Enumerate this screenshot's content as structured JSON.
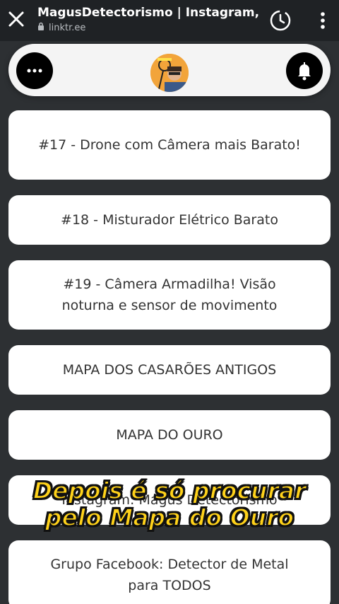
{
  "browser": {
    "title": "MagusDetectorismo | Instagram,",
    "url": "linktr.ee"
  },
  "header": {
    "menu_icon": "more-horizontal-icon",
    "notify_icon": "bell-icon",
    "avatar_alt": "profile avatar"
  },
  "links": [
    {
      "label": "#17 - Drone com Câmera mais Barato!"
    },
    {
      "label": "#18 - Misturador Elétrico Barato"
    },
    {
      "label": "#19 - Câmera Armadilha! Visão noturna e sensor de movimento"
    },
    {
      "label": "MAPA DOS CASARÕES ANTIGOS"
    },
    {
      "label": "MAPA DO OURO"
    },
    {
      "label": "Instagram: Magus Detectorismo"
    },
    {
      "label": "Grupo Facebook: Detector de Metal para TODOS"
    }
  ],
  "caption": {
    "line1": "Depois é só procurar",
    "line2": "pelo Mapa do Ouro"
  },
  "colors": {
    "page_bg": "#2d3033",
    "caption": "#ffd21a"
  }
}
